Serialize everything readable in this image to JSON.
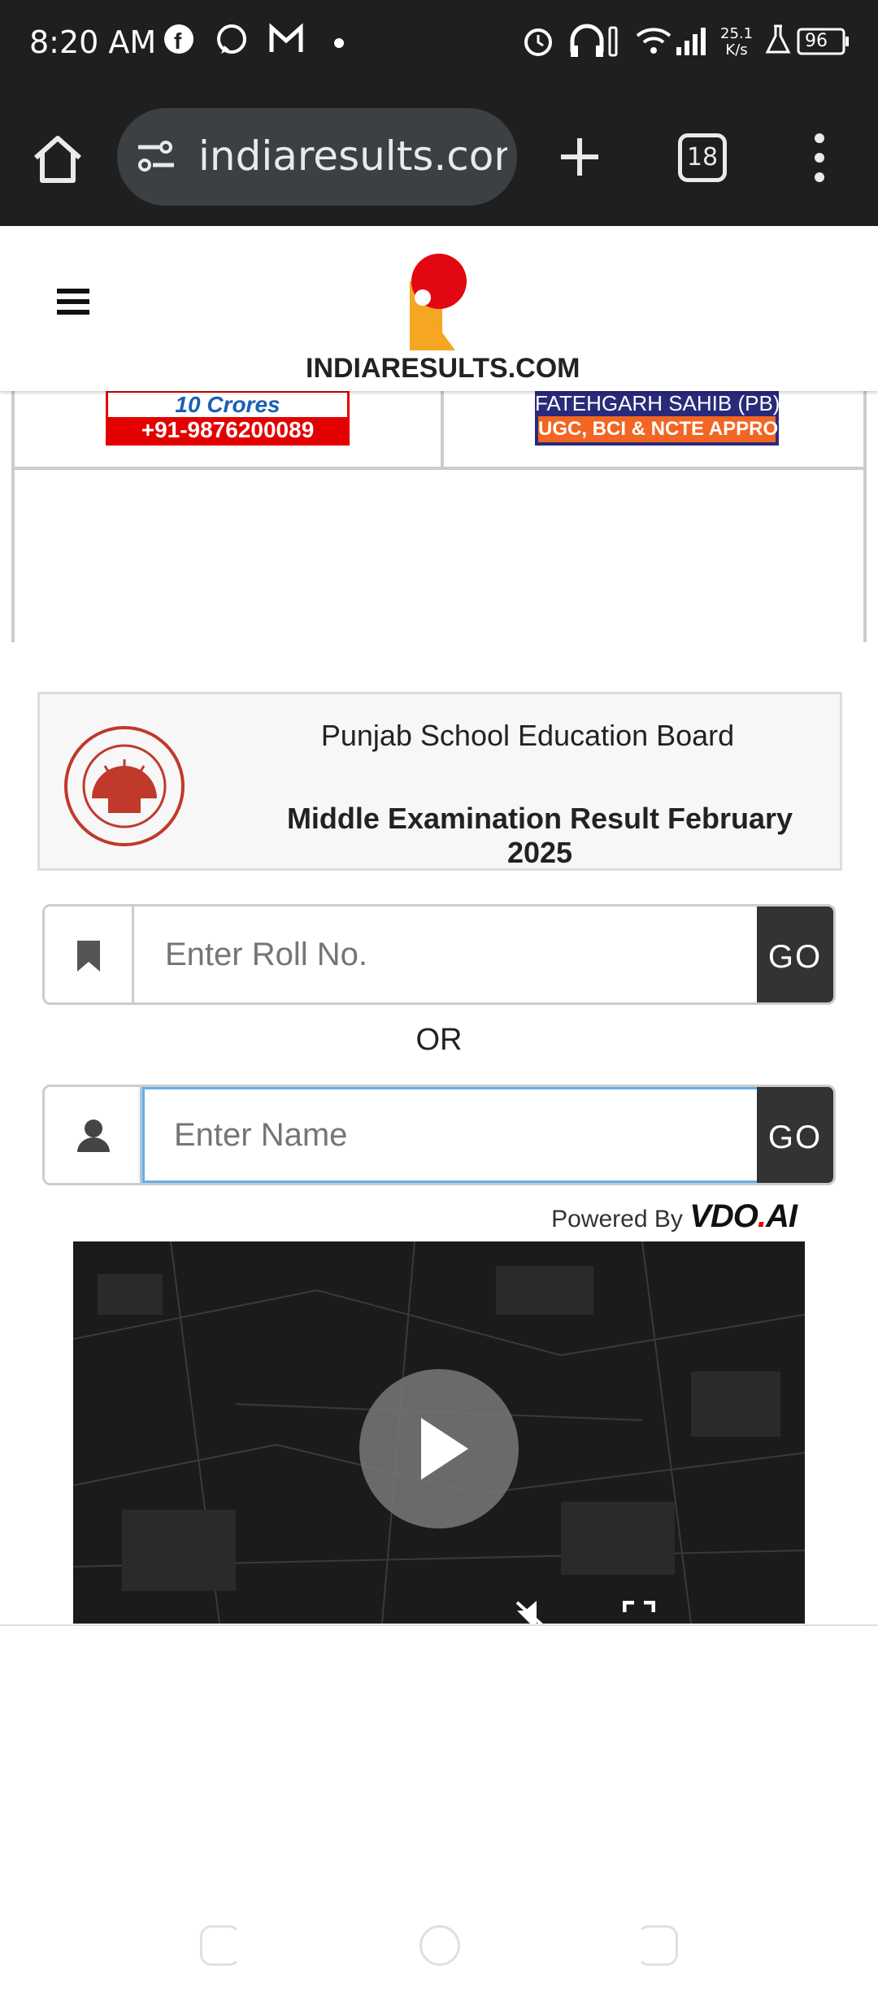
{
  "status_bar": {
    "time": "8:20 AM",
    "net_speed_top": "25.1",
    "net_speed_bottom": "K/s",
    "battery": "96"
  },
  "browser": {
    "url": "indiaresults.com",
    "tab_count": "18"
  },
  "site": {
    "logo_text": "INDIARESULTS.COM"
  },
  "ads": {
    "left_line1": "10 Crores",
    "left_line2": "+91-9876200089",
    "right_line1": "FATEHGARH SAHIB (PB)",
    "right_line2": "UGC, BCI & NCTE APPROVED"
  },
  "board": {
    "name": "Punjab School Education Board",
    "exam": "Middle Examination Result February 2025"
  },
  "search": {
    "roll_placeholder": "Enter Roll No.",
    "go_label": "GO",
    "or_label": "OR",
    "name_placeholder": "Enter Name"
  },
  "ad_video": {
    "powered_by": "Powered By",
    "brand_left": "VDO",
    "brand_dot": ".",
    "brand_right": "AI"
  },
  "colors": {
    "dark_bar": "#1f1f1f",
    "go_button": "#333333",
    "logo_red": "#e30613",
    "logo_orange": "#f5a623",
    "brand_dot": "#e30000"
  }
}
